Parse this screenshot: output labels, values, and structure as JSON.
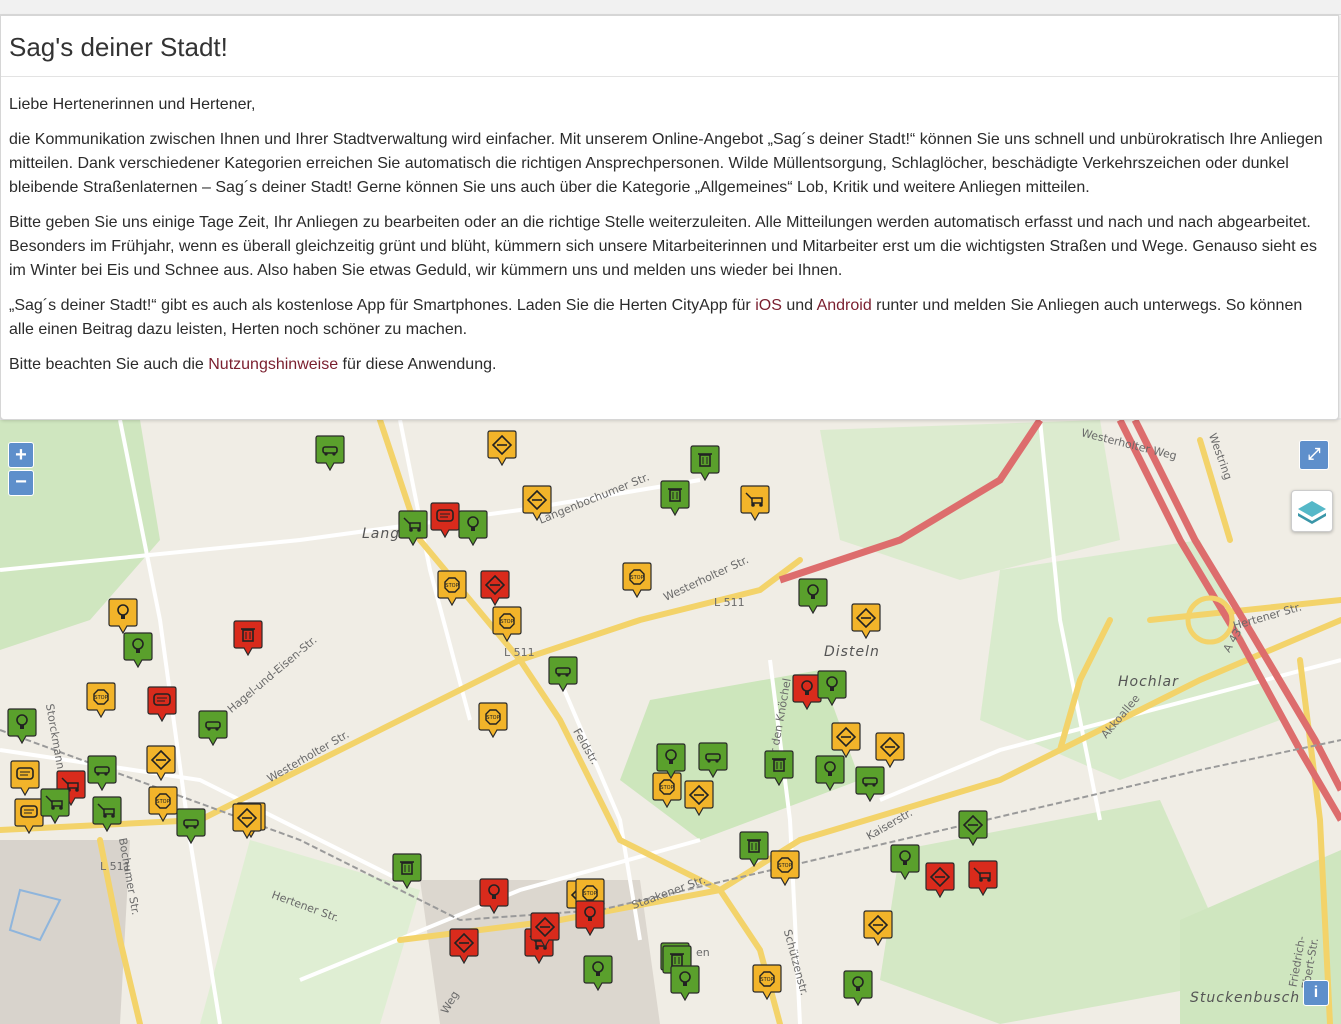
{
  "header": {
    "title": "Sag's deiner Stadt!"
  },
  "intro": {
    "greeting": "Liebe Hertenerinnen und Hertener,",
    "p1": "die Kommunikation zwischen Ihnen und Ihrer Stadtverwaltung wird einfacher. Mit unserem Online-Angebot „Sag´s deiner Stadt!“ können Sie uns schnell und unbürokratisch Ihre Anliegen mitteilen. Dank verschiedener Kategorien erreichen Sie automatisch die richtigen Ansprechpersonen. Wilde Müllentsorgung, Schlaglöcher, beschädigte Verkehrszeichen oder dunkel bleibende Straßenlaternen – Sag´s deiner Stadt! Gerne können Sie uns auch über die Kategorie „Allgemeines“ Lob, Kritik und weitere Anliegen mitteilen.",
    "p2": "Bitte geben Sie uns einige Tage Zeit, Ihr Anliegen zu bearbeiten oder an die richtige Stelle weiterzuleiten. Alle Mitteilungen werden automatisch erfasst und nach und nach abgearbeitet. Besonders im Frühjahr, wenn es überall gleichzeitig grünt und blüht, kümmern sich unsere Mitarbeiterinnen und Mitarbeiter erst um die wichtigsten Straßen und Wege. Genauso sieht es im Winter bei Eis und Schnee aus. Also haben Sie etwas Geduld, wir kümmern uns und melden uns wieder bei Ihnen.",
    "p3_before": "„Sag´s deiner Stadt!“ gibt es auch als kostenlose App für Smartphones. Laden Sie die Herten CityApp für ",
    "p3_ios": "iOS",
    "p3_and": " und ",
    "p3_android": "Android",
    "p3_after": " runter und melden Sie Anliegen auch unterwegs. So können alle einen Beitrag dazu leisten, Herten noch schöner zu machen.",
    "p4_before": "Bitte beachten Sie auch die ",
    "p4_link": "Nutzungshinweise",
    "p4_after": " für diese Anwendung."
  },
  "map": {
    "controls": {
      "zoom_in": "+",
      "zoom_out": "−",
      "fullscreen": "⤢",
      "info": "i"
    },
    "places": {
      "langenbochum": "Lang",
      "disteln": "Disteln",
      "hochlar": "Hochlar",
      "stuckenbusch": "Stuckenbusch"
    },
    "streets": {
      "s1": "Langenbochumer Str.",
      "s2": "Westerholter Str.",
      "s3": "L 511",
      "s4": "Westerholter Weg",
      "s5": "Hertener Str.",
      "s6": "A 43",
      "s7": "Akkoallee",
      "s8": "Kaiserstr.",
      "s9": "Staakener Str.",
      "s10": "Feldstr.",
      "s11": "Über den Knöchel",
      "s12": "Schützenstr.",
      "s13": "Bochumer Str.",
      "s14": "Friedrich-Ebert-Str.",
      "s15": "Westring",
      "s16": "Hagel-und-Eisen-Str.",
      "s17": "Storckmann",
      "s18": "Weg",
      "s19": "en"
    },
    "colors": {
      "green": "#5aa02c",
      "yellow": "#f2b42a",
      "red": "#d92b1c"
    },
    "markers": [
      {
        "c": "green",
        "i": "car-icon"
      },
      {
        "c": "yellow",
        "i": "sign-icon"
      },
      {
        "c": "green",
        "i": "trash-icon"
      },
      {
        "c": "green",
        "i": "trash-icon"
      },
      {
        "c": "yellow",
        "i": "sign-icon"
      },
      {
        "c": "yellow",
        "i": "mower-icon"
      },
      {
        "c": "red",
        "i": "chat-icon"
      },
      {
        "c": "green",
        "i": "bulb-icon"
      },
      {
        "c": "green",
        "i": "mower-icon"
      },
      {
        "c": "yellow",
        "i": "stop-icon"
      },
      {
        "c": "red",
        "i": "sign-icon"
      },
      {
        "c": "yellow",
        "i": "stop-icon"
      },
      {
        "c": "yellow",
        "i": "stop-icon"
      },
      {
        "c": "green",
        "i": "bulb-icon"
      },
      {
        "c": "yellow",
        "i": "sign-icon"
      },
      {
        "c": "yellow",
        "i": "bulb-icon"
      },
      {
        "c": "red",
        "i": "trash-icon"
      },
      {
        "c": "green",
        "i": "bulb-icon"
      },
      {
        "c": "green",
        "i": "car-icon"
      },
      {
        "c": "yellow",
        "i": "stop-icon"
      },
      {
        "c": "red",
        "i": "chat-icon"
      },
      {
        "c": "green",
        "i": "car-icon"
      },
      {
        "c": "green",
        "i": "bulb-icon"
      },
      {
        "c": "yellow",
        "i": "chat-icon"
      },
      {
        "c": "red",
        "i": "mower-icon"
      },
      {
        "c": "green",
        "i": "car-icon"
      },
      {
        "c": "yellow",
        "i": "sign-icon"
      },
      {
        "c": "yellow",
        "i": "stop-icon"
      },
      {
        "c": "green",
        "i": "mower-icon"
      },
      {
        "c": "green",
        "i": "car-icon"
      },
      {
        "c": "yellow",
        "i": "chat-icon"
      },
      {
        "c": "yellow",
        "i": "sign-icon"
      },
      {
        "c": "yellow",
        "i": "stop-icon"
      },
      {
        "c": "green",
        "i": "trash-icon"
      },
      {
        "c": "red",
        "i": "bulb-icon"
      },
      {
        "c": "green",
        "i": "bulb-icon"
      },
      {
        "c": "yellow",
        "i": "sign-icon"
      },
      {
        "c": "yellow",
        "i": "sign-icon"
      },
      {
        "c": "green",
        "i": "car-icon"
      },
      {
        "c": "green",
        "i": "bulb-icon"
      },
      {
        "c": "yellow",
        "i": "stop-icon"
      },
      {
        "c": "yellow",
        "i": "sign-icon"
      },
      {
        "c": "green",
        "i": "bulb-icon"
      },
      {
        "c": "green",
        "i": "trash-icon"
      },
      {
        "c": "green",
        "i": "trash-icon"
      },
      {
        "c": "yellow",
        "i": "stop-icon"
      },
      {
        "c": "green",
        "i": "bulb-icon"
      },
      {
        "c": "red",
        "i": "sign-icon"
      },
      {
        "c": "red",
        "i": "mower-icon"
      },
      {
        "c": "green",
        "i": "sign-icon"
      },
      {
        "c": "yellow",
        "i": "sign-icon"
      },
      {
        "c": "green",
        "i": "car-icon"
      },
      {
        "c": "yellow",
        "i": "sign-icon"
      },
      {
        "c": "green",
        "i": "trash-icon"
      },
      {
        "c": "red",
        "i": "bulb-icon"
      },
      {
        "c": "yellow",
        "i": "stop-icon"
      },
      {
        "c": "red",
        "i": "bulb-icon"
      },
      {
        "c": "red",
        "i": "sign-icon"
      },
      {
        "c": "red",
        "i": "mower-icon"
      },
      {
        "c": "red",
        "i": "sign-icon"
      },
      {
        "c": "green",
        "i": "trash-icon"
      },
      {
        "c": "green",
        "i": "bulb-icon"
      },
      {
        "c": "green",
        "i": "bulb-icon"
      },
      {
        "c": "yellow",
        "i": "stop-icon"
      },
      {
        "c": "green",
        "i": "bulb-icon"
      },
      {
        "c": "yellow",
        "i": "sign-icon"
      },
      {
        "c": "green",
        "i": "mower-icon"
      },
      {
        "c": "green",
        "i": "bulb-icon"
      }
    ]
  }
}
